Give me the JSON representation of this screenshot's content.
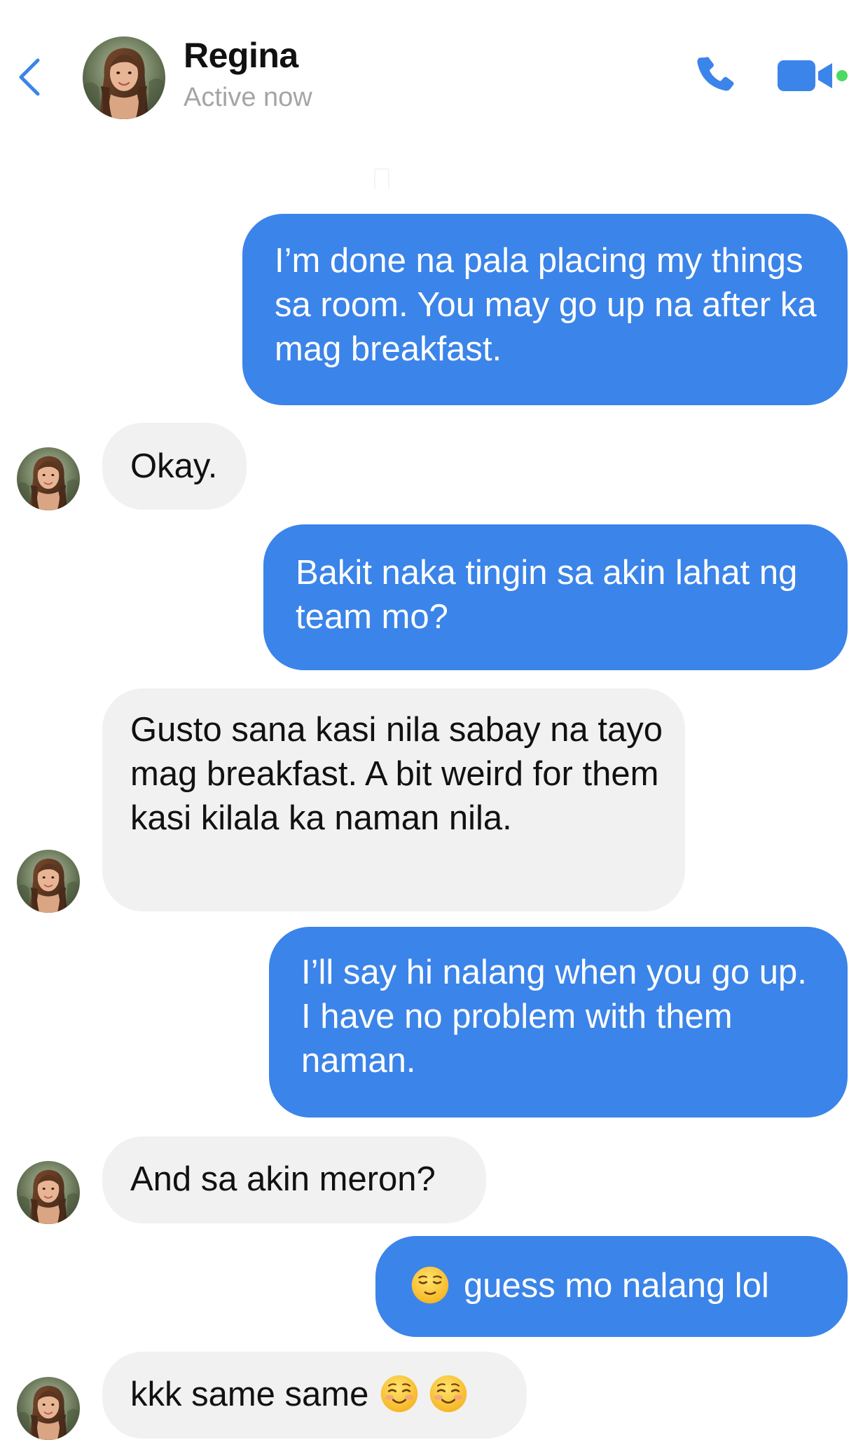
{
  "header": {
    "contact_name": "Regina",
    "contact_status": "Active now",
    "icons": {
      "back": "chevron-left-icon",
      "call": "phone-icon",
      "video": "video-camera-icon",
      "online": "online-dot-icon"
    },
    "colors": {
      "accent": "#3b84e9",
      "online": "#4cd964"
    }
  },
  "colors": {
    "sent_bubble": "#3b84e9",
    "received_bubble": "#f1f1f1"
  },
  "messages": [
    {
      "direction": "sent",
      "text": "I’m done na pala placing my things sa room. You may go up na after ka mag breakfast."
    },
    {
      "direction": "received",
      "text": "Okay."
    },
    {
      "direction": "sent",
      "text": "Bakit naka tingin sa akin lahat ng team mo?"
    },
    {
      "direction": "received",
      "text": "Gusto sana kasi nila sabay na tayo mag breakfast. A bit weird for them kasi kilala ka naman nila."
    },
    {
      "direction": "sent",
      "text": "I’ll say hi nalang when you go up. I have no problem with them naman."
    },
    {
      "direction": "received",
      "text": "And sa akin meron?"
    },
    {
      "direction": "sent",
      "text": "guess mo nalang lol",
      "emoji_before": "relieved-face-emoji"
    },
    {
      "direction": "received",
      "text": "kkk same same",
      "emoji_after": [
        "smiling-face-emoji",
        "smiling-face-emoji"
      ]
    }
  ]
}
